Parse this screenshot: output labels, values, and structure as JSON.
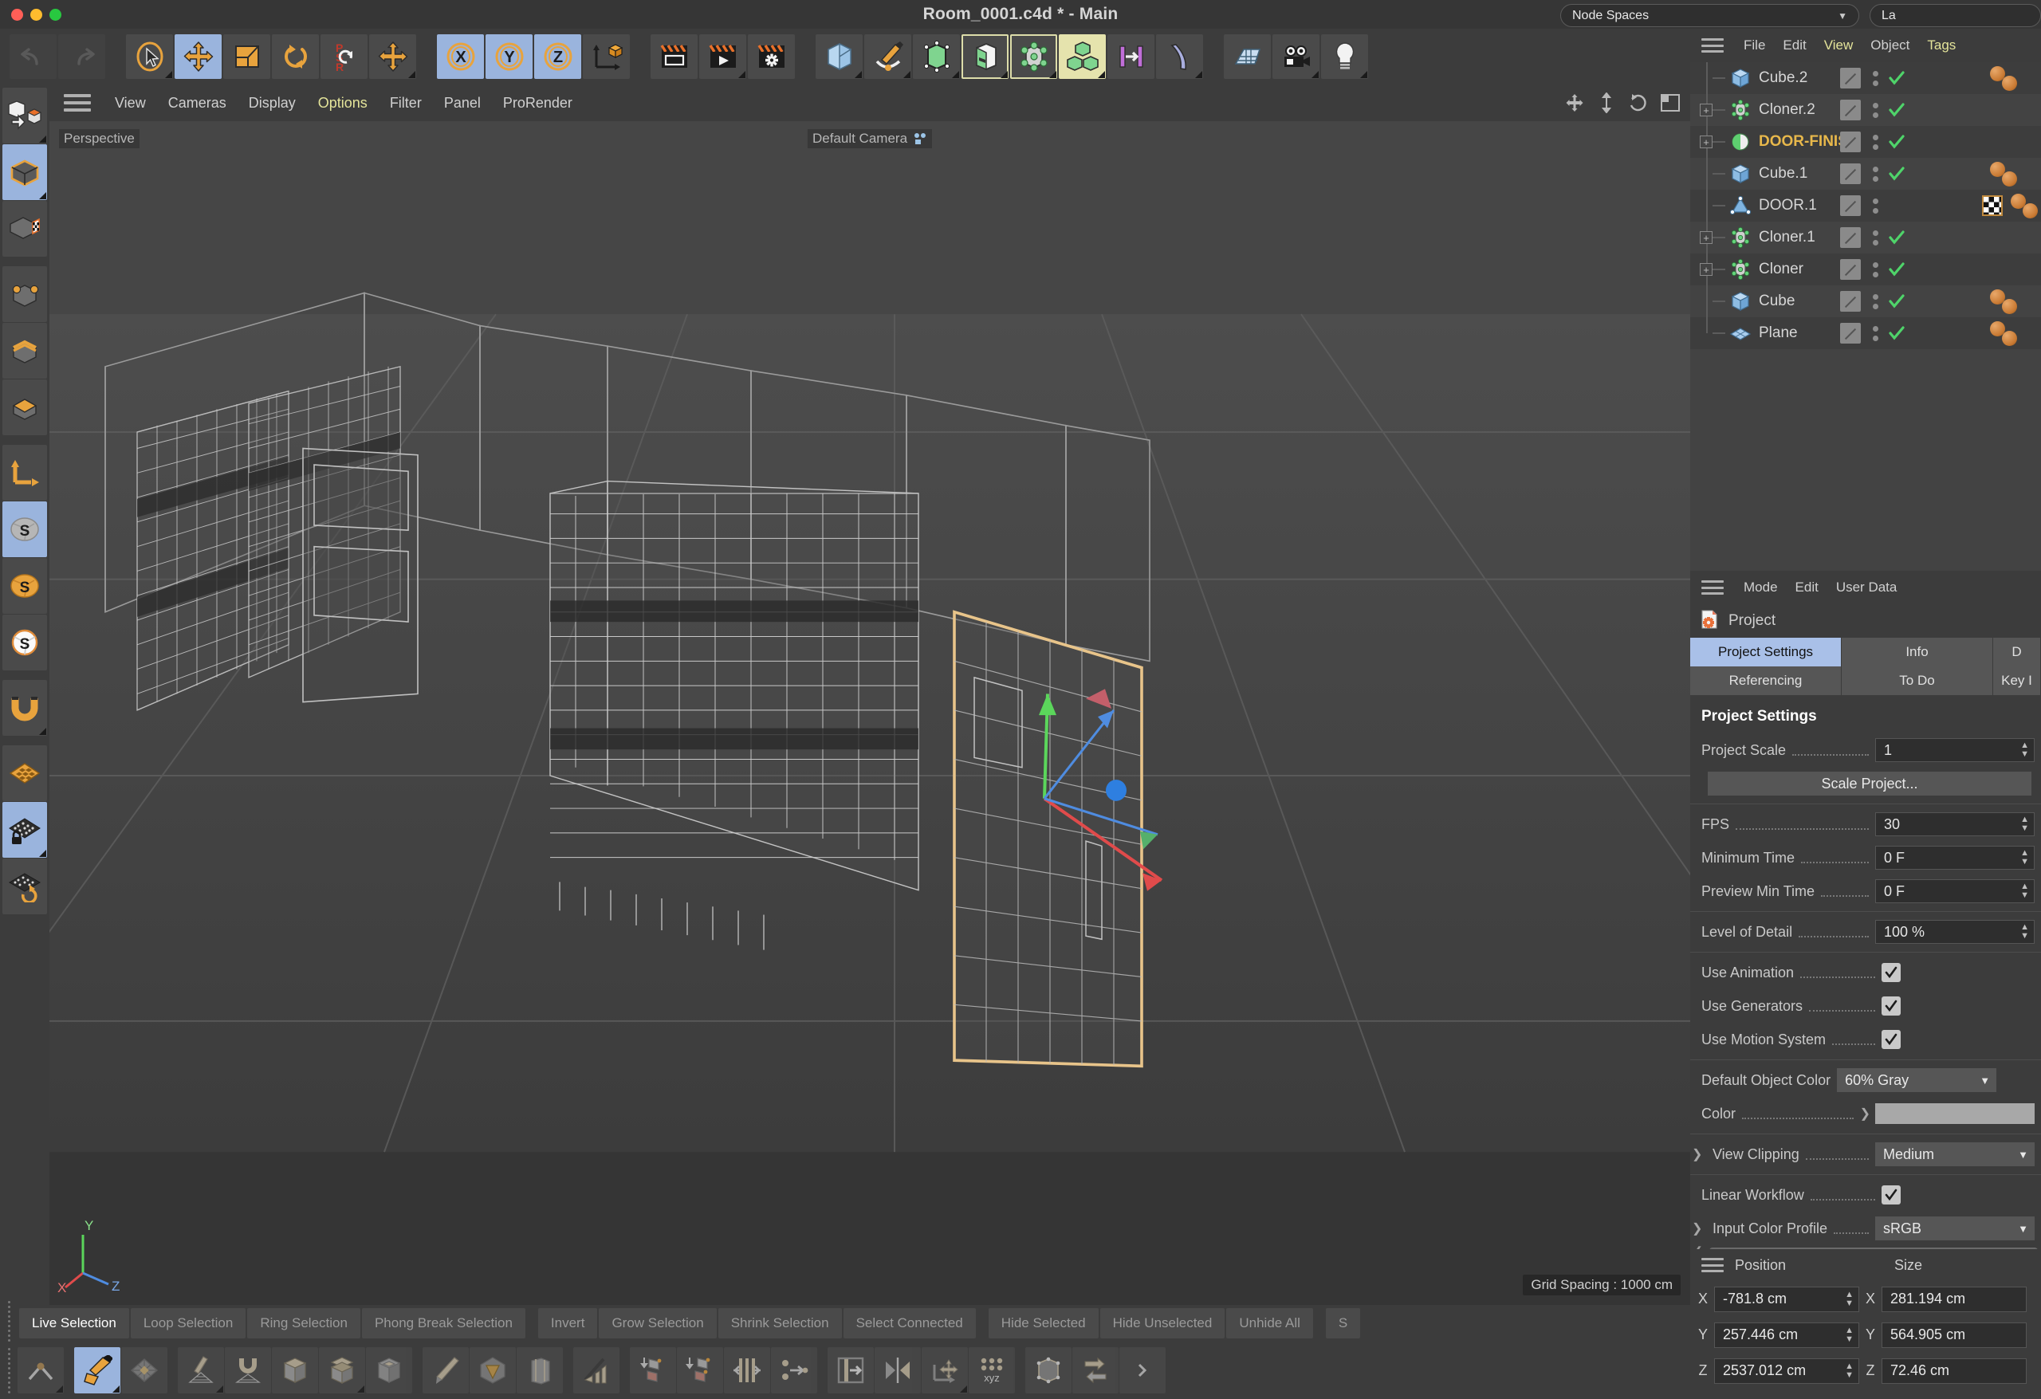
{
  "window": {
    "title": "Room_0001.c4d * - Main",
    "node_spaces_label": "Node Spaces",
    "layout_label": "La"
  },
  "toolbar": {
    "groups": [
      {
        "name": "history",
        "buttons": [
          {
            "name": "undo-button",
            "icon": "undo-icon",
            "state": "disabled"
          },
          {
            "name": "redo-button",
            "icon": "redo-icon",
            "state": "disabled"
          }
        ]
      },
      {
        "name": "transform",
        "buttons": [
          {
            "name": "live-selection-button",
            "icon": "cursor-icon",
            "state": "normal"
          },
          {
            "name": "move-button",
            "icon": "move-icon",
            "state": "selected"
          },
          {
            "name": "scale-button",
            "icon": "scale-icon",
            "state": "normal"
          },
          {
            "name": "rotate-button",
            "icon": "rotate-icon",
            "state": "normal"
          },
          {
            "name": "psr-button",
            "icon": "psr-icon",
            "state": "normal"
          },
          {
            "name": "move-alt-button",
            "icon": "move-icon",
            "state": "normal"
          }
        ]
      },
      {
        "name": "axis-locks",
        "buttons": [
          {
            "name": "lock-x-button",
            "icon": "axis-x-icon",
            "state": "selected",
            "label": "X"
          },
          {
            "name": "lock-y-button",
            "icon": "axis-y-icon",
            "state": "selected",
            "label": "Y"
          },
          {
            "name": "lock-z-button",
            "icon": "axis-z-icon",
            "state": "selected",
            "label": "Z"
          },
          {
            "name": "world-object-coordinates-button",
            "icon": "world-axis-icon",
            "state": "normal"
          }
        ]
      },
      {
        "name": "render",
        "buttons": [
          {
            "name": "render-view-button",
            "icon": "render-view-icon",
            "state": "normal"
          },
          {
            "name": "render-to-picture-viewer-button",
            "icon": "render-picture-icon",
            "state": "normal"
          },
          {
            "name": "render-settings-button",
            "icon": "render-settings-icon",
            "state": "normal"
          }
        ]
      },
      {
        "name": "create",
        "buttons": [
          {
            "name": "add-cube-button",
            "icon": "cube-icon",
            "state": "normal"
          },
          {
            "name": "add-spline-button",
            "icon": "pen-spline-icon",
            "state": "normal"
          },
          {
            "name": "add-nurbs-button",
            "icon": "subdivision-surface-icon",
            "state": "normal"
          },
          {
            "name": "add-array-button",
            "icon": "boole-icon",
            "state": "outlined"
          },
          {
            "name": "add-deformer-button",
            "icon": "atom-array-icon",
            "state": "outlined"
          },
          {
            "name": "mograph-cloner-button",
            "icon": "cloner-cubes-icon",
            "state": "selected-green"
          },
          {
            "name": "add-field-button",
            "icon": "linear-field-icon",
            "state": "normal"
          },
          {
            "name": "add-bend-button",
            "icon": "bend-deformer-icon",
            "state": "normal"
          }
        ]
      },
      {
        "name": "scene",
        "buttons": [
          {
            "name": "add-environment-button",
            "icon": "floor-grid-icon",
            "state": "normal"
          },
          {
            "name": "add-camera-button",
            "icon": "camera-icon",
            "state": "normal"
          },
          {
            "name": "add-light-button",
            "icon": "light-bulb-icon",
            "state": "normal"
          }
        ]
      }
    ]
  },
  "left_toolbar": {
    "buttons": [
      {
        "name": "make-editable-button",
        "icon": "make-editable-icon",
        "state": "normal"
      },
      {
        "name": "model-mode-button",
        "icon": "model-mode-icon",
        "state": "selected"
      },
      {
        "name": "texture-mode-button",
        "icon": "texture-mode-icon",
        "state": "normal"
      },
      {
        "name": "points-mode-button",
        "icon": "points-mode-icon",
        "state": "normal"
      },
      {
        "name": "edges-mode-button",
        "icon": "edges-mode-icon",
        "state": "normal"
      },
      {
        "name": "polygons-mode-button",
        "icon": "polygons-mode-icon",
        "state": "normal"
      },
      {
        "name": "axis-mode-button",
        "icon": "axis-mode-icon",
        "state": "normal"
      },
      {
        "name": "enable-axis-button",
        "icon": "s-gray-icon",
        "state": "selected"
      },
      {
        "name": "viewport-solo-button",
        "icon": "s-orange-icon",
        "state": "normal"
      },
      {
        "name": "solo-single-button",
        "icon": "s-white-icon",
        "state": "normal"
      },
      {
        "name": "snap-button",
        "icon": "magnet-icon",
        "state": "normal"
      },
      {
        "name": "workplane-button",
        "icon": "workplane-orange-icon",
        "state": "normal"
      },
      {
        "name": "lock-workplane-button",
        "icon": "workplane-lock-icon",
        "state": "selected"
      },
      {
        "name": "planar-workplane-button",
        "icon": "workplane-rotate-icon",
        "state": "normal"
      }
    ]
  },
  "viewport": {
    "menu": [
      {
        "label": "View",
        "active": false
      },
      {
        "label": "Cameras",
        "active": false
      },
      {
        "label": "Display",
        "active": false
      },
      {
        "label": "Options",
        "active": true
      },
      {
        "label": "Filter",
        "active": false
      },
      {
        "label": "Panel",
        "active": false
      },
      {
        "label": "ProRender",
        "active": false
      }
    ],
    "projection_label": "Perspective",
    "camera_label": "Default Camera",
    "grid_spacing_label": "Grid Spacing : 1000 cm",
    "axis_x": "X",
    "axis_y": "Y",
    "axis_z": "Z"
  },
  "selection_bar": {
    "buttons": [
      {
        "label": "Live Selection",
        "active": true
      },
      {
        "label": "Loop Selection",
        "active": false
      },
      {
        "label": "Ring Selection",
        "active": false
      },
      {
        "label": "Phong Break Selection",
        "active": false
      },
      {
        "label": "Invert",
        "active": false
      },
      {
        "label": "Grow Selection",
        "active": false
      },
      {
        "label": "Shrink Selection",
        "active": false
      },
      {
        "label": "Select Connected",
        "active": false
      },
      {
        "label": "Hide Selected",
        "active": false
      },
      {
        "label": "Hide Unselected",
        "active": false
      },
      {
        "label": "Unhide All",
        "active": false
      }
    ]
  },
  "icon_bar": {
    "buttons": [
      {
        "name": "bevel-tool-button",
        "icon": "bevel-icon"
      },
      {
        "name": "polygon-pen-button",
        "icon": "polygon-pen-icon",
        "state": "selected"
      },
      {
        "name": "uv-grid-button",
        "icon": "uv-grid-icon"
      },
      {
        "name": "brush-button",
        "icon": "brush-icon"
      },
      {
        "name": "magnet-tool-button",
        "icon": "magnet-tool-icon"
      },
      {
        "name": "extrude-button",
        "icon": "extrude-icon"
      },
      {
        "name": "extrude-inner-button",
        "icon": "extrude-inner-icon"
      },
      {
        "name": "bevel-poly-button",
        "icon": "bevel-poly-icon"
      },
      {
        "name": "knife-button",
        "icon": "knife-icon"
      },
      {
        "name": "melt-button",
        "icon": "melt-icon"
      },
      {
        "name": "close-polygon-hole-button",
        "icon": "close-hole-icon"
      },
      {
        "name": "slide-button",
        "icon": "slide-icon"
      },
      {
        "name": "mirror-button",
        "icon": "mirror-tool-icon"
      },
      {
        "name": "array-button",
        "icon": "array-icon"
      },
      {
        "name": "clone-button",
        "icon": "clone-icon"
      },
      {
        "name": "center-axis-button",
        "icon": "center-axis-icon"
      },
      {
        "name": "align-button",
        "icon": "align-icon"
      },
      {
        "name": "symmetry-button",
        "icon": "symmetry-icon"
      },
      {
        "name": "reset-psr-button",
        "icon": "reset-psr-icon"
      },
      {
        "name": "xyz-button",
        "icon": "xyz-icon"
      },
      {
        "name": "optimize-button",
        "icon": "optimize-icon"
      },
      {
        "name": "transfer-button",
        "icon": "transfer-icon"
      }
    ]
  },
  "object_manager": {
    "menu": [
      {
        "label": "File",
        "active": false
      },
      {
        "label": "Edit",
        "active": false
      },
      {
        "label": "View",
        "active": true
      },
      {
        "label": "Object",
        "active": false
      },
      {
        "label": "Tags",
        "active": true
      }
    ],
    "objects": [
      {
        "name": "Cube.2",
        "icon": "cube-blue-icon",
        "expandable": false,
        "highlighted": false,
        "visibility_dots": true,
        "check": true,
        "tags": [
          "material",
          "material"
        ]
      },
      {
        "name": "Cloner.2",
        "icon": "cloner-icon",
        "expandable": true,
        "highlighted": false,
        "visibility_dots": true,
        "check": true,
        "tags": []
      },
      {
        "name": "DOOR-FINISH",
        "icon": "sphere-green-icon",
        "expandable": true,
        "highlighted": true,
        "visibility_dots": true,
        "check": true,
        "tags": []
      },
      {
        "name": "Cube.1",
        "icon": "cube-blue-icon",
        "expandable": false,
        "highlighted": false,
        "visibility_dots": true,
        "check": true,
        "tags": [
          "material",
          "material"
        ]
      },
      {
        "name": "DOOR.1",
        "icon": "polygon-blue-icon",
        "expandable": false,
        "highlighted": false,
        "visibility_dots": true,
        "check": false,
        "tags": [
          "checker",
          "material",
          "material"
        ]
      },
      {
        "name": "Cloner.1",
        "icon": "cloner-icon",
        "expandable": true,
        "highlighted": false,
        "visibility_dots": true,
        "check": true,
        "tags": []
      },
      {
        "name": "Cloner",
        "icon": "cloner-icon",
        "expandable": true,
        "highlighted": false,
        "visibility_dots": true,
        "check": true,
        "tags": []
      },
      {
        "name": "Cube",
        "icon": "cube-blue-icon",
        "expandable": false,
        "highlighted": false,
        "visibility_dots": true,
        "check": true,
        "tags": [
          "material",
          "material"
        ]
      },
      {
        "name": "Plane",
        "icon": "plane-blue-icon",
        "expandable": false,
        "highlighted": false,
        "visibility_dots": true,
        "check": true,
        "tags": [
          "material",
          "material"
        ]
      }
    ]
  },
  "attributes": {
    "menu": [
      {
        "label": "Mode"
      },
      {
        "label": "Edit"
      },
      {
        "label": "User Data"
      }
    ],
    "object_name": "Project",
    "tabs_row1": [
      {
        "label": "Project Settings",
        "active": true
      },
      {
        "label": "Info",
        "active": false
      },
      {
        "label": "D",
        "active": false
      }
    ],
    "tabs_row2": [
      {
        "label": "Referencing",
        "active": false
      },
      {
        "label": "To Do",
        "active": false
      },
      {
        "label": "Key I",
        "active": false
      }
    ],
    "section_title": "Project Settings",
    "fields": {
      "project_scale_label": "Project Scale",
      "project_scale_value": "1",
      "scale_project_button": "Scale Project...",
      "fps_label": "FPS",
      "fps_value": "30",
      "minimum_time_label": "Minimum Time",
      "minimum_time_value": "0 F",
      "preview_min_time_label": "Preview Min Time",
      "preview_min_time_value": "0 F",
      "level_of_detail_label": "Level of Detail",
      "level_of_detail_value": "100 %",
      "use_animation_label": "Use Animation",
      "use_animation_checked": true,
      "use_generators_label": "Use Generators",
      "use_generators_checked": true,
      "use_motion_system_label": "Use Motion System",
      "use_motion_system_checked": true,
      "default_object_color_label": "Default Object Color",
      "default_object_color_value": "60% Gray",
      "color_label": "Color",
      "color_swatch": "#a8a8a8",
      "view_clipping_label": "View Clipping",
      "view_clipping_value": "Medium",
      "linear_workflow_label": "Linear Workflow",
      "linear_workflow_checked": true,
      "input_color_profile_label": "Input Color Profile",
      "input_color_profile_value": "sRGB"
    }
  },
  "coordinates": {
    "position_header": "Position",
    "size_header": "Size",
    "position": {
      "x": "-781.8 cm",
      "y": "257.446 cm",
      "z": "2537.012 cm"
    },
    "size": {
      "x": "281.194 cm",
      "y": "564.905 cm",
      "z": "72.46 cm"
    },
    "axis_labels": [
      "X",
      "Y",
      "Z"
    ]
  },
  "colors": {
    "accent_orange": "#e8a33d",
    "accent_blue": "#9ab4dd",
    "highlight_yellow": "#e8b84b",
    "panel_bg": "#3c3c3c",
    "viewport_bg": "#2d2d2d"
  }
}
